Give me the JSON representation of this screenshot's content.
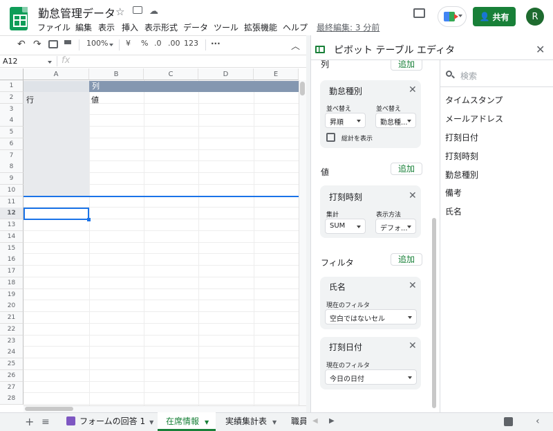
{
  "doc": {
    "title": "勤怠管理データ",
    "last_edit": "最終編集: 3 分前"
  },
  "menu": [
    "ファイル",
    "編集",
    "表示",
    "挿入",
    "表示形式",
    "データ",
    "ツール",
    "拡張機能",
    "ヘルプ"
  ],
  "header": {
    "share_label": "共有",
    "avatar_letter": "R"
  },
  "toolbar": {
    "zoom": "100%",
    "currency": "¥",
    "percent": "%",
    "dec_dec": ".0",
    "dec_inc": ".00",
    "format": "123"
  },
  "formula": {
    "cell_ref": "A12",
    "fx": "fx"
  },
  "grid": {
    "columns": [
      "A",
      "B",
      "C",
      "D",
      "E"
    ],
    "rows": [
      "1",
      "2",
      "3",
      "4",
      "5",
      "6",
      "7",
      "8",
      "9",
      "10",
      "11",
      "12",
      "13",
      "14",
      "15",
      "16",
      "17",
      "18",
      "19",
      "20",
      "21",
      "22",
      "23",
      "24",
      "25",
      "26",
      "27",
      "28"
    ],
    "b1": "列",
    "a2": "行",
    "b2": "値"
  },
  "pivot": {
    "title": "ピボット テーブル エディタ",
    "columns_label": "列",
    "columns_add": "追加",
    "col_field": {
      "name": "勤怠種別",
      "sort_label": "並べ替え",
      "sort_value": "昇順",
      "sortby_label": "並べ替え",
      "sortby_value": "勤怠種...",
      "totals_label": "総計を表示"
    },
    "values_label": "値",
    "values_add": "追加",
    "val_field": {
      "name": "打刻時刻",
      "agg_label": "集計",
      "agg_value": "SUM",
      "show_label": "表示方法",
      "show_value": "デフォ..."
    },
    "filters_label": "フィルタ",
    "filters_add": "追加",
    "filter1": {
      "name": "氏名",
      "label": "現在のフィルタ",
      "value": "空白ではないセル"
    },
    "filter2": {
      "name": "打刻日付",
      "label": "現在のフィルタ",
      "value": "今日の日付"
    },
    "search_placeholder": "検索",
    "fields": [
      "タイムスタンプ",
      "メールアドレス",
      "打刻日付",
      "打刻時刻",
      "勤怠種別",
      "備考",
      "氏名"
    ]
  },
  "sheets": {
    "tabs": [
      "フォームの回答 1",
      "在席情報",
      "実績集計表",
      "職員"
    ],
    "active": "在席情報"
  },
  "colors": {
    "accent": "#188038",
    "pivot_header": "#8497b0",
    "selection": "#1a73e8"
  }
}
